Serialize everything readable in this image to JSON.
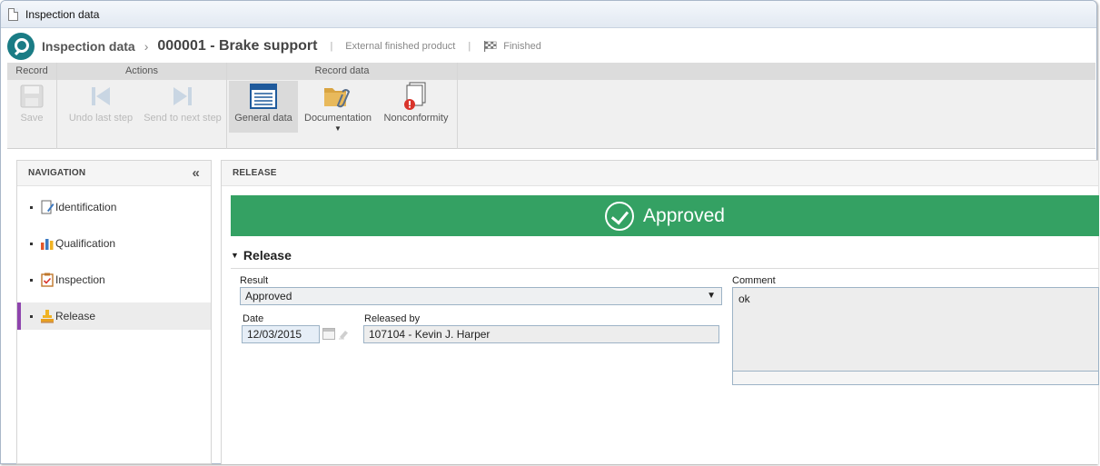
{
  "window": {
    "title": "Inspection data"
  },
  "header": {
    "module": "Inspection data",
    "record": "000001 - Brake support",
    "product_type": "External finished product",
    "status": "Finished"
  },
  "ribbon": {
    "groups": {
      "record": "Record",
      "actions": "Actions",
      "record_data": "Record data"
    },
    "buttons": {
      "save": "Save",
      "undo_last_step": "Undo last step",
      "send_to_next_step": "Send to next step",
      "general_data": "General data",
      "documentation": "Documentation",
      "nonconformity": "Nonconformity"
    }
  },
  "navigation": {
    "title": "NAVIGATION",
    "items": [
      {
        "label": "Identification",
        "icon": "document-edit-icon"
      },
      {
        "label": "Qualification",
        "icon": "bar-chart-icon"
      },
      {
        "label": "Inspection",
        "icon": "clipboard-check-icon"
      },
      {
        "label": "Release",
        "icon": "stamp-icon",
        "selected": true
      }
    ]
  },
  "release": {
    "panel_title": "RELEASE",
    "banner": "Approved",
    "section_title": "Release",
    "result_label": "Result",
    "result_value": "Approved",
    "date_label": "Date",
    "date_value": "12/03/2015",
    "released_by_label": "Released by",
    "released_by_value": "107104 - Kevin J. Harper",
    "comment_label": "Comment",
    "comment_value": "ok"
  },
  "colors": {
    "approved_green": "#34a163",
    "logo_teal": "#1a7c85",
    "selected_accent": "#8e44ad"
  }
}
